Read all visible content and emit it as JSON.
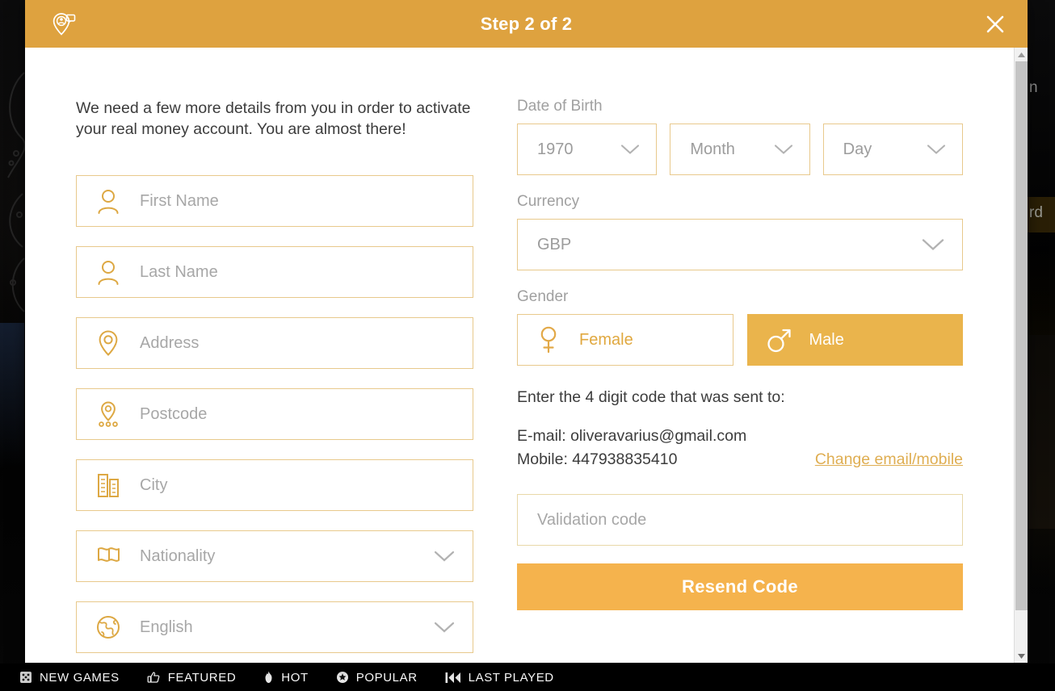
{
  "modal": {
    "title": "Step 2 of 2",
    "brand_icon": "location-pin-support-icon",
    "close_icon": "close-icon",
    "intro": "We need a few more details from you in order to activate your real money account. You are almost there!",
    "left_fields": [
      {
        "name": "first-name",
        "placeholder": "First Name",
        "icon": "person-icon",
        "type": "text"
      },
      {
        "name": "last-name",
        "placeholder": "Last Name",
        "icon": "person-icon",
        "type": "text"
      },
      {
        "name": "address",
        "placeholder": "Address",
        "icon": "map-pin-icon",
        "type": "text"
      },
      {
        "name": "postcode",
        "placeholder": "Postcode",
        "icon": "postcode-pin-icon",
        "type": "text"
      },
      {
        "name": "city",
        "placeholder": "City",
        "icon": "building-icon",
        "type": "text"
      },
      {
        "name": "nationality",
        "placeholder": "Nationality",
        "icon": "flag-icon",
        "type": "select"
      },
      {
        "name": "language",
        "placeholder": "English",
        "icon": "globe-icon",
        "type": "select"
      }
    ],
    "date_of_birth": {
      "label": "Date of Birth",
      "year": "1970",
      "month": "Month",
      "day": "Day"
    },
    "currency": {
      "label": "Currency",
      "value": "GBP"
    },
    "gender": {
      "label": "Gender",
      "options": [
        {
          "label": "Female",
          "icon": "female-symbol-icon",
          "selected": false
        },
        {
          "label": "Male",
          "icon": "male-symbol-icon",
          "selected": true
        }
      ]
    },
    "verification": {
      "prompt": "Enter the 4 digit code that was sent to:",
      "email_line": "E-mail: oliveravarius@gmail.com",
      "mobile_line": "Mobile: 447938835410",
      "change_link": "Change email/mobile",
      "code_placeholder": "Validation code",
      "resend_label": "Resend Code"
    },
    "scrollbar": {
      "up_icon": "scroll-up-arrow-icon",
      "down_icon": "scroll-down-arrow-icon"
    }
  },
  "background": {
    "clipped_text_top": "n",
    "clipped_text_mid": "rd",
    "bottom_nav": [
      {
        "label": "NEW GAMES",
        "icon": "dice-icon"
      },
      {
        "label": "FEATURED",
        "icon": "thumbs-up-icon"
      },
      {
        "label": "HOT",
        "icon": "flame-icon"
      },
      {
        "label": "POPULAR",
        "icon": "star-circle-icon"
      },
      {
        "label": "LAST PLAYED",
        "icon": "rewind-icon"
      }
    ]
  },
  "colors": {
    "header_orange": "#dea23f",
    "accent_orange": "#eab44c",
    "button_orange": "#f5b34d",
    "border_gold": "#e8c98c",
    "placeholder_gray": "#a7a7a7"
  }
}
